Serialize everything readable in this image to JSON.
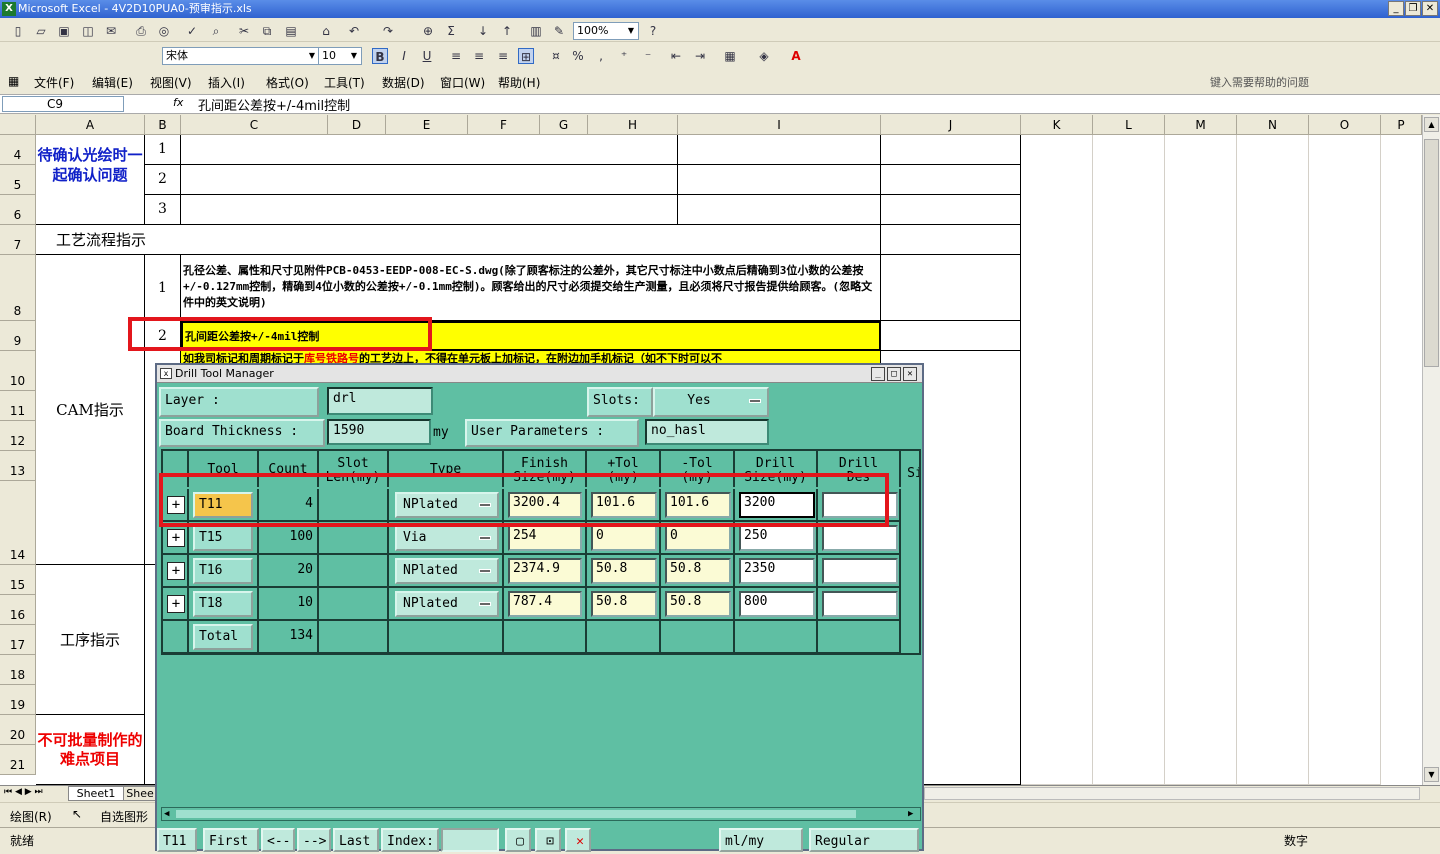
{
  "window": {
    "title": "Microsoft Excel - 4V2D10PUA0-预审指示.xls"
  },
  "toolbar": {
    "zoom": "100%",
    "font_name": "宋体",
    "font_size": "10"
  },
  "menu": {
    "items": [
      "文件(F)",
      "编辑(E)",
      "视图(V)",
      "插入(I)",
      "格式(O)",
      "工具(T)",
      "数据(D)",
      "窗口(W)",
      "帮助(H)"
    ],
    "help_placeholder": "键入需要帮助的问题"
  },
  "formula_bar": {
    "cell_ref": "C9",
    "fx": "fx",
    "content": "孔间距公差按+/-4mil控制"
  },
  "sheet": {
    "columns": [
      "A",
      "B",
      "C",
      "D",
      "E",
      "F",
      "G",
      "H",
      "I",
      "J",
      "K",
      "L",
      "M",
      "N",
      "O",
      "P"
    ],
    "rows": [
      "4",
      "5",
      "6",
      "7",
      "8",
      "9",
      "10",
      "11",
      "12",
      "13",
      "14",
      "15",
      "16",
      "17",
      "18",
      "19",
      "20",
      "21"
    ],
    "confirm_label": "待确认光绘时一起确认问题",
    "confirm_nums": [
      "1",
      "2",
      "3"
    ],
    "process_label": "工艺流程指示",
    "cam_label": "CAM指示",
    "cam_item1_num": "1",
    "cam_item1_text": "孔径公差、属性和尺寸见附件PCB-0453-EEDP-008-EC-S.dwg(除了顾客标注的公差外，其它尺寸标注中小数点后精确到3位小数的公差按+/-0.127mm控制，精确到4位小数的公差按+/-0.1mm控制)。顾客给出的尺寸必须提交给生产测量，且必须将尺寸报告提供给顾客。(忽略文件中的英文说明)",
    "cam_item2_num": "2",
    "cam_item2_text": "孔间距公差按+/-4mil控制",
    "cam_item3_a": "如我司标记和周期标记于",
    "cam_item3_red": "库号铁路号",
    "cam_item3_b": "的工艺边上，不得在单元板上加标记，在附边加手机标记（如不下时可以不",
    "op_label": "工序指示",
    "hard_label": "不可批量制作的难点项目"
  },
  "sheet_tabs": [
    "Sheet1",
    "Shee"
  ],
  "drawbar": {
    "draw": "绘图(R)",
    "autoshape": "自选图形"
  },
  "status": {
    "left": "就绪",
    "right": "数字"
  },
  "dialog": {
    "title": "Drill Tool Manager",
    "layer_label": "Layer      :",
    "layer_value": "drl",
    "slots_label": "Slots:",
    "slots_value": "Yes",
    "thickness_label": "Board Thickness :",
    "thickness_value": "1590",
    "thickness_unit": "my",
    "user_params_label": "User Parameters :",
    "user_params_value": "no_hasl",
    "headers": [
      "Tool",
      "Count",
      "Slot\nLen(my)",
      "Type",
      "Finish\nSize(my)",
      "+Tol\n(my)",
      "-Tol\n(my)",
      "Drill\nSize(my)",
      "Drill\nDes",
      "Si"
    ],
    "rows": [
      {
        "tool": "T11",
        "count": "4",
        "type": "NPlated",
        "finish": "3200.4",
        "ptol": "101.6",
        "mtol": "101.6",
        "drill": "3200"
      },
      {
        "tool": "T15",
        "count": "100",
        "type": "Via",
        "finish": "254",
        "ptol": "0",
        "mtol": "0",
        "drill": "250"
      },
      {
        "tool": "T16",
        "count": "20",
        "type": "NPlated",
        "finish": "2374.9",
        "ptol": "50.8",
        "mtol": "50.8",
        "drill": "2350"
      },
      {
        "tool": "T18",
        "count": "10",
        "type": "NPlated",
        "finish": "787.4",
        "ptol": "50.8",
        "mtol": "50.8",
        "drill": "800"
      }
    ],
    "total_label": "Total",
    "total_value": "134",
    "bottom": {
      "tool": "T11",
      "first": "First",
      "prev": "<--",
      "next": "-->",
      "last": "Last",
      "index": "Index:",
      "units": "ml/my",
      "mode": "Regular"
    }
  }
}
